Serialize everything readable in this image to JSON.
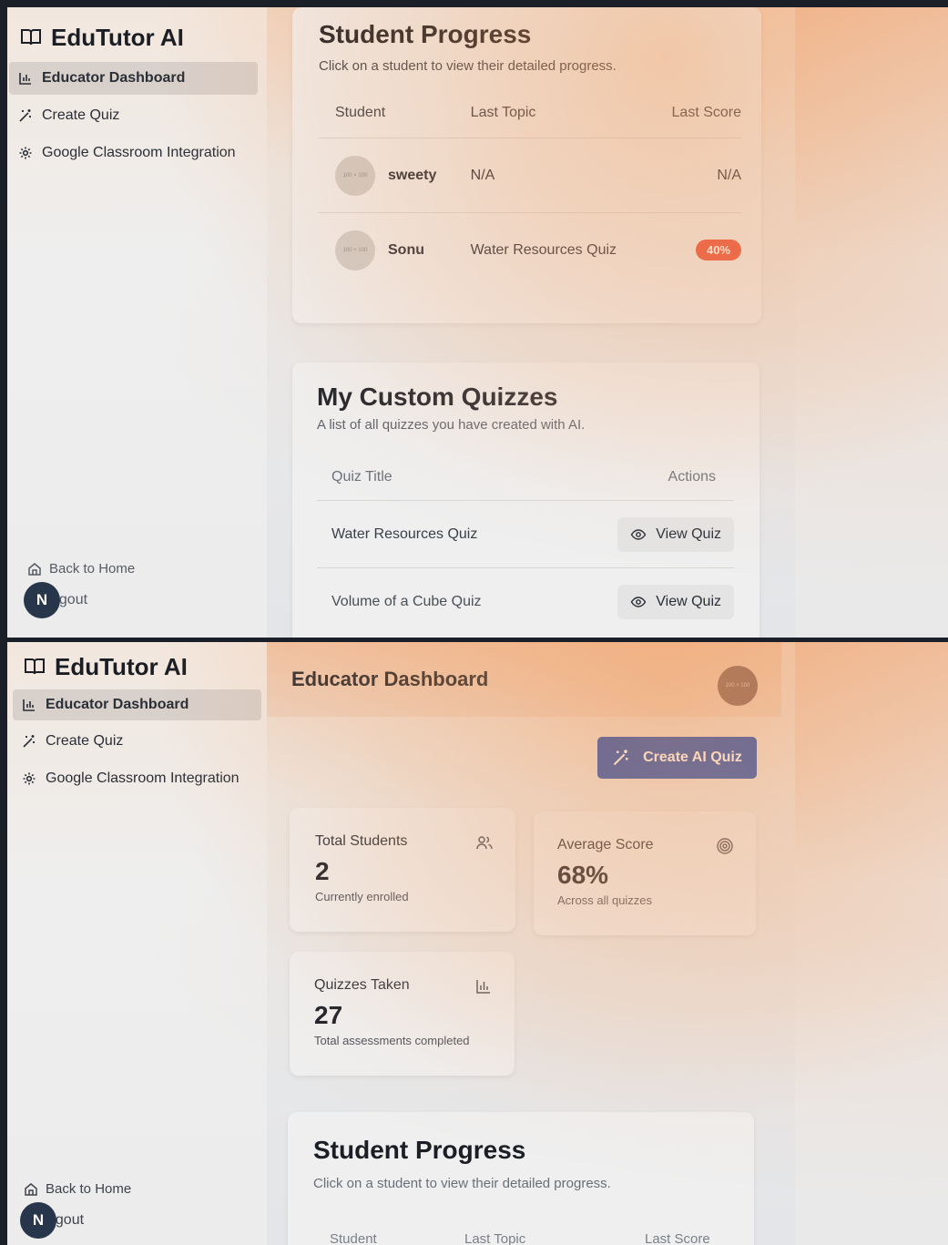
{
  "brand": {
    "name": "EduTutor AI"
  },
  "nav": {
    "items": [
      {
        "label": "Educator Dashboard"
      },
      {
        "label": "Create Quiz"
      },
      {
        "label": "Google Classroom Integration"
      }
    ]
  },
  "footer": {
    "back_home": "Back to Home",
    "logout": "ogout",
    "avatar_initial": "N"
  },
  "header": {
    "title": "Educator Dashboard",
    "avatar_text": "100 × 100"
  },
  "create_button": {
    "label": "Create AI Quiz"
  },
  "stats": {
    "total_students": {
      "title": "Total Students",
      "value": "2",
      "note": "Currently enrolled"
    },
    "average_score": {
      "title": "Average Score",
      "value": "68%",
      "note": "Across all quizzes"
    },
    "quizzes_taken": {
      "title": "Quizzes Taken",
      "value": "27",
      "note": "Total assessments completed"
    }
  },
  "student_progress": {
    "title": "Student Progress",
    "subtitle": "Click on a student to view their detailed progress.",
    "columns": {
      "student": "Student",
      "last_topic": "Last Topic",
      "last_score": "Last Score"
    },
    "rows": [
      {
        "name": "sweety",
        "topic": "N/A",
        "score": "N/A",
        "avatar_text": "100 × 100"
      },
      {
        "name": "Sonu",
        "topic": "Water Resources Quiz",
        "score": "40%",
        "avatar_text": "100 × 100"
      }
    ]
  },
  "custom_quizzes": {
    "title": "My Custom Quizzes",
    "subtitle": "A list of all quizzes you have created with AI.",
    "columns": {
      "title": "Quiz Title",
      "actions": "Actions"
    },
    "rows": [
      {
        "title": "Water Resources Quiz",
        "action": "View Quiz"
      },
      {
        "title": "Volume of a Cube Quiz",
        "action": "View Quiz"
      }
    ]
  },
  "colors": {
    "accent": "#1f4fb5",
    "danger": "#e8402b",
    "sidebar_active": "#d8d0cb"
  }
}
